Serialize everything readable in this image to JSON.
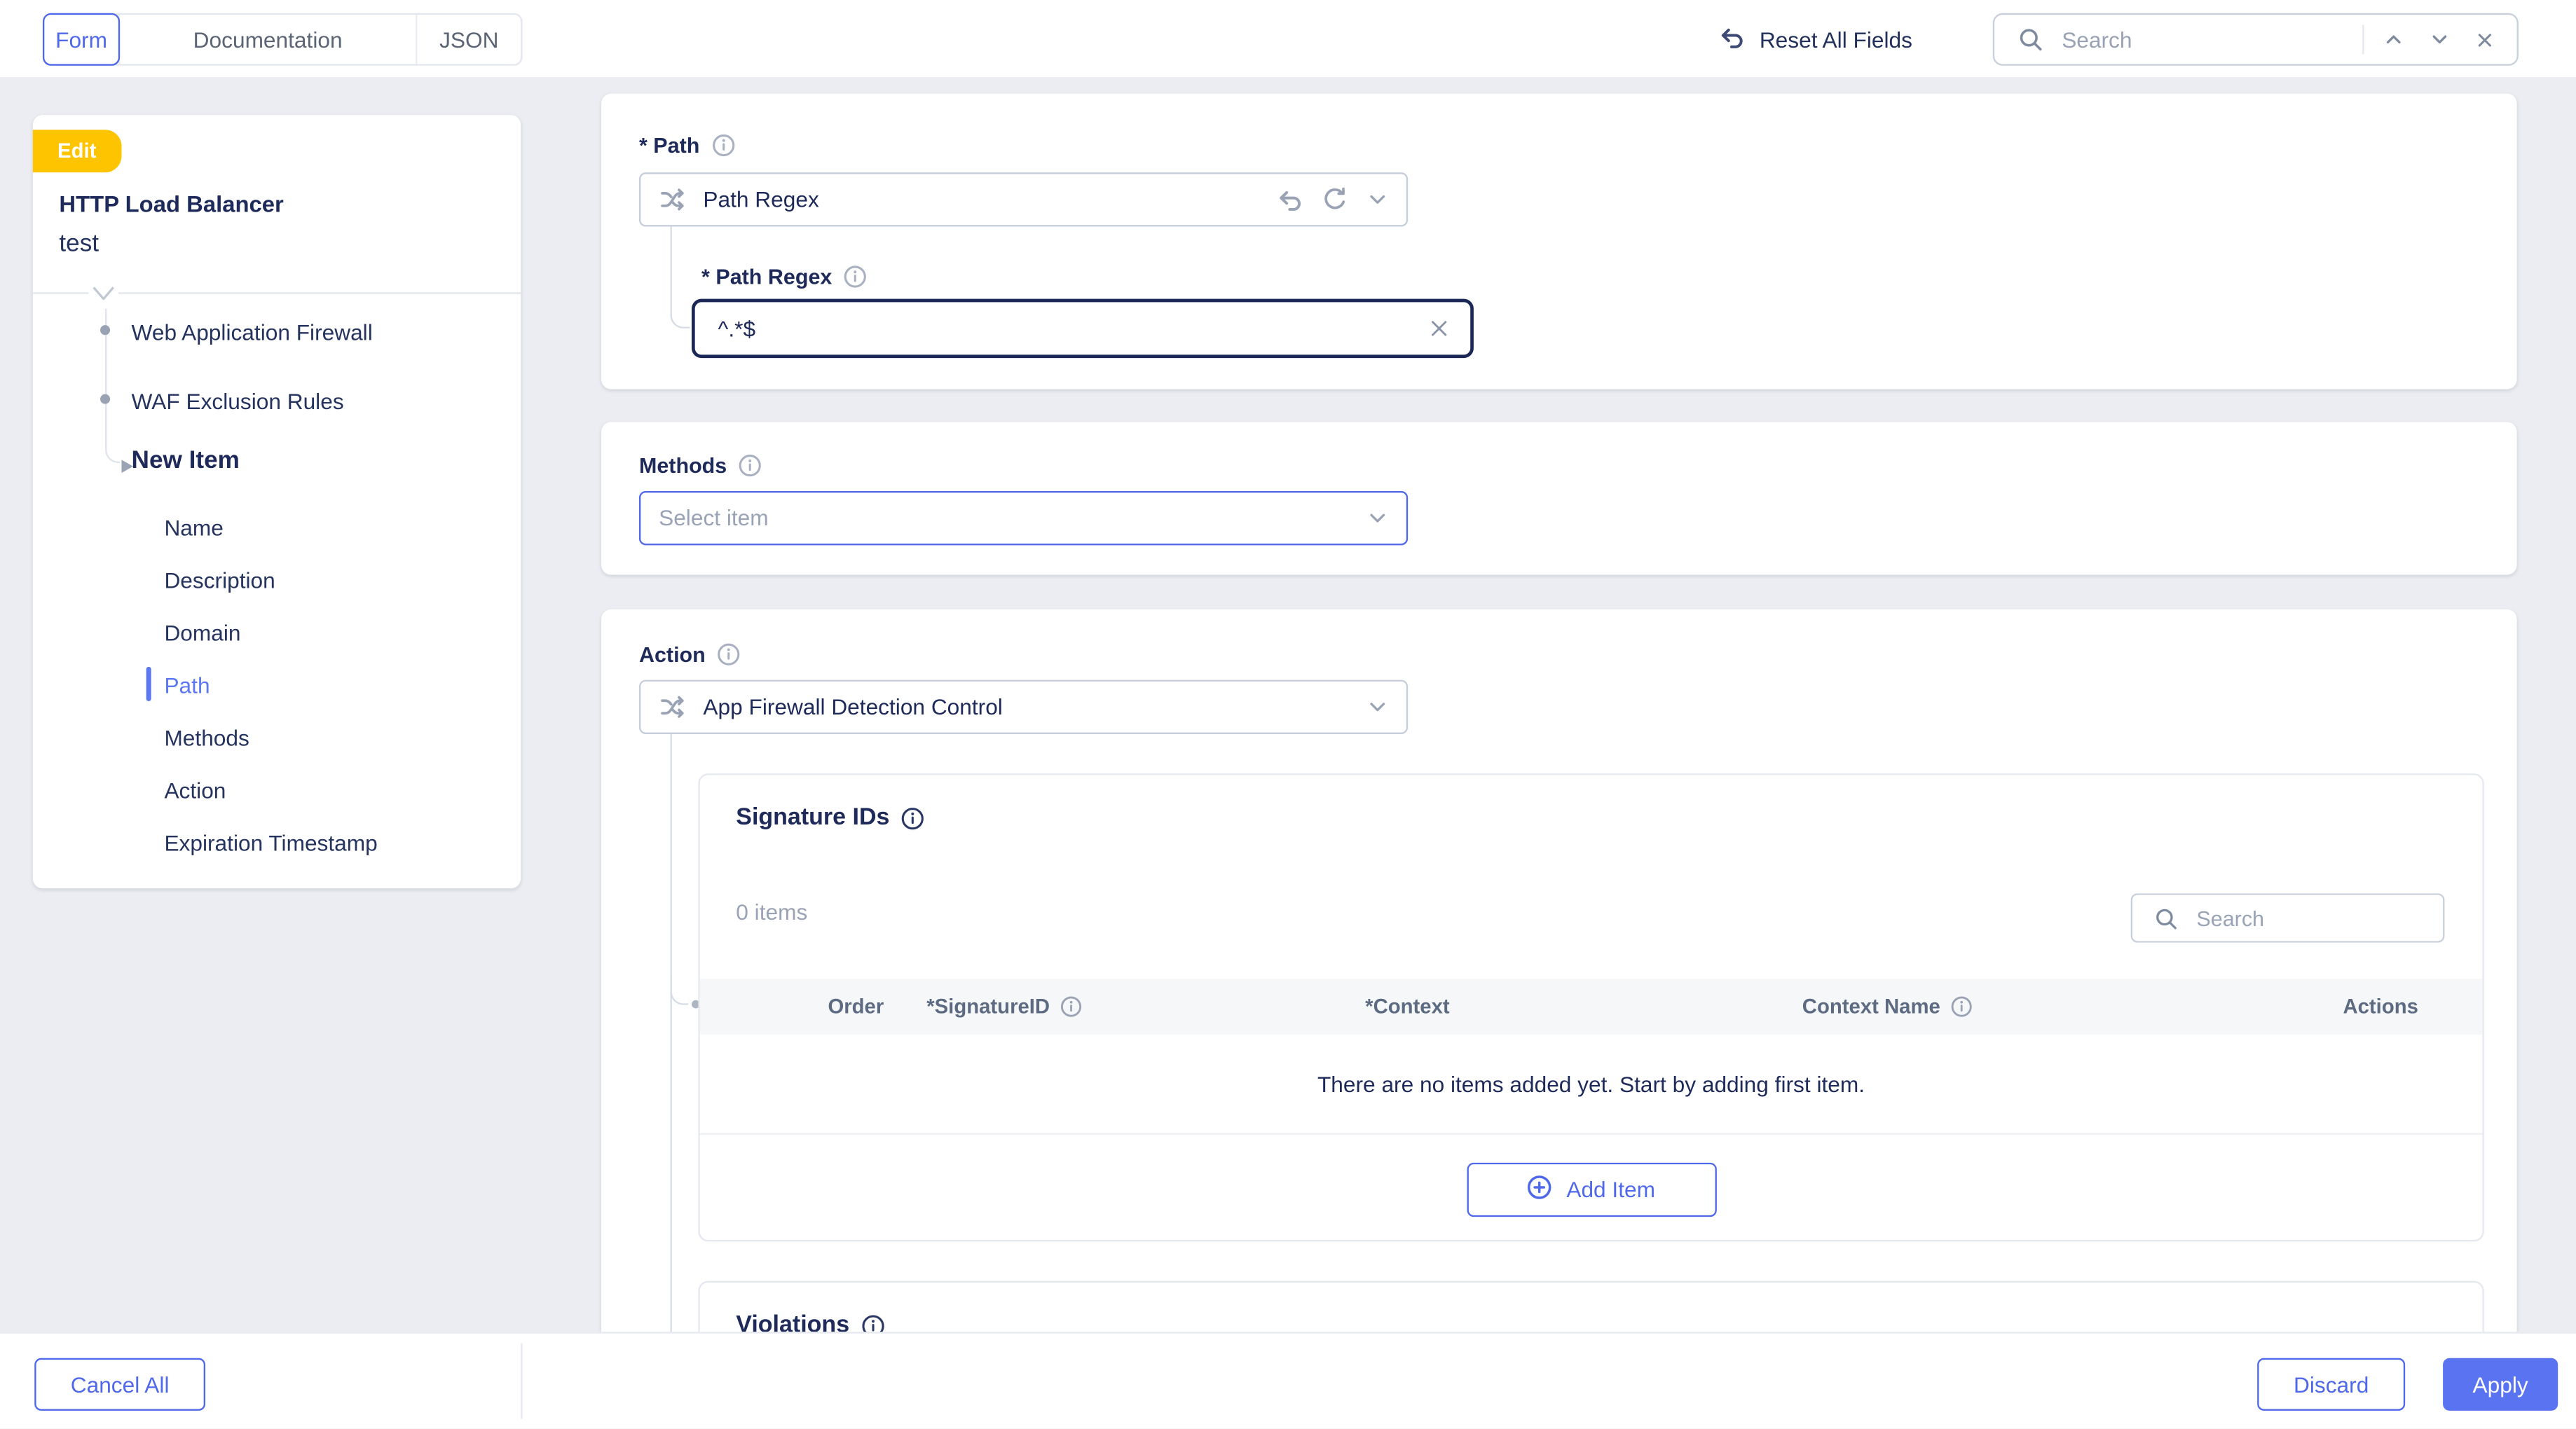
{
  "topbar": {
    "tabs": [
      {
        "label": "Form",
        "active": true
      },
      {
        "label": "Documentation",
        "active": false
      },
      {
        "label": "JSON",
        "active": false
      }
    ],
    "reset_label": "Reset All Fields",
    "search": {
      "placeholder": "Search"
    }
  },
  "sidebar": {
    "badge": "Edit",
    "object_type": "HTTP Load Balancer",
    "object_name": "test",
    "tree": [
      {
        "label": "Web Application Firewall"
      },
      {
        "label": "WAF Exclusion Rules"
      },
      {
        "label": "New Item"
      },
      {
        "label": "Name"
      },
      {
        "label": "Description"
      },
      {
        "label": "Domain"
      },
      {
        "label": "Path",
        "active": true
      },
      {
        "label": "Methods"
      },
      {
        "label": "Action"
      },
      {
        "label": "Expiration Timestamp"
      }
    ]
  },
  "form": {
    "path": {
      "label": "* Path",
      "select_value": "Path Regex",
      "child_label": "* Path Regex",
      "input_value": "^.*$"
    },
    "methods": {
      "label": "Methods",
      "placeholder": "Select item"
    },
    "action": {
      "label": "Action",
      "select_value": "App Firewall Detection Control"
    },
    "signature_ids": {
      "title": "Signature IDs",
      "items_count": "0 items",
      "search_placeholder": "Search",
      "columns": [
        {
          "label": "Order"
        },
        {
          "label": "*SignatureID",
          "info": true
        },
        {
          "label": "*Context"
        },
        {
          "label": "Context Name",
          "info": true
        },
        {
          "label": "Actions"
        }
      ],
      "empty_text": "There are no items added yet. Start by adding first item.",
      "add_item_label": "Add Item"
    },
    "violations": {
      "title": "Violations"
    }
  },
  "footer": {
    "cancel_all": "Cancel All",
    "discard": "Discard",
    "apply": "Apply"
  },
  "colors": {
    "accent_blue": "#5068ea",
    "apply_fill": "#5a74f1",
    "active_item_blue": "#5b78f2",
    "badge_yellow": "#ffc400",
    "navy_text": "#1e2a5a",
    "page_background": "#ecedf2"
  }
}
